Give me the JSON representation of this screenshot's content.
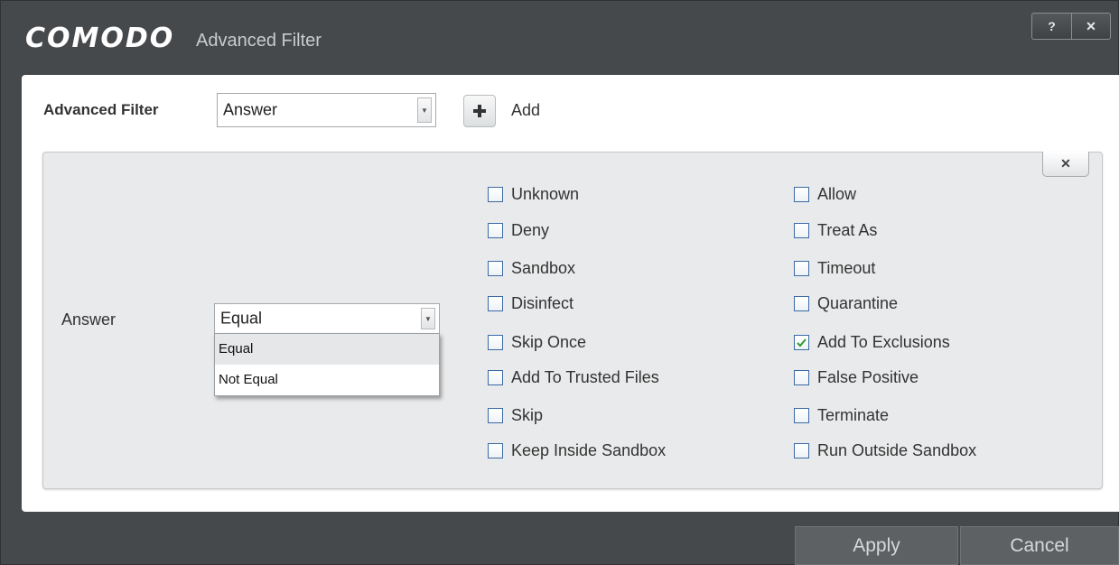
{
  "titlebar": {
    "brand": "COMODO",
    "title": "Advanced Filter",
    "help_label": "?",
    "close_label": "✕"
  },
  "filter": {
    "label": "Advanced Filter",
    "selected": "Answer",
    "add_label": "Add"
  },
  "panel": {
    "close_label": "✕",
    "answer_label": "Answer",
    "operator_selected": "Equal",
    "operator_options": [
      "Equal",
      "Not Equal"
    ]
  },
  "checkboxes": {
    "left": [
      {
        "label": "Unknown",
        "checked": false
      },
      {
        "label": "Deny",
        "checked": false
      },
      {
        "label": "Sandbox",
        "checked": false
      },
      {
        "label": "Disinfect",
        "checked": false
      },
      {
        "label": "Skip Once",
        "checked": false
      },
      {
        "label": "Add To Trusted Files",
        "checked": false
      },
      {
        "label": "Skip",
        "checked": false
      },
      {
        "label": "Keep Inside Sandbox",
        "checked": false
      }
    ],
    "right": [
      {
        "label": "Allow",
        "checked": false
      },
      {
        "label": "Treat As",
        "checked": false
      },
      {
        "label": "Timeout",
        "checked": false
      },
      {
        "label": "Quarantine",
        "checked": false
      },
      {
        "label": "Add To Exclusions",
        "checked": true
      },
      {
        "label": "False Positive",
        "checked": false
      },
      {
        "label": "Terminate",
        "checked": false
      },
      {
        "label": "Run Outside Sandbox",
        "checked": false
      }
    ]
  },
  "footer": {
    "apply_label": "Apply",
    "cancel_label": "Cancel"
  },
  "colors": {
    "window_bg": "#46494c",
    "panel_bg": "#e9eaeb",
    "checkbox_border": "#3c6aa6",
    "check_mark": "#2e9a2e",
    "add_icon": "#333333"
  }
}
